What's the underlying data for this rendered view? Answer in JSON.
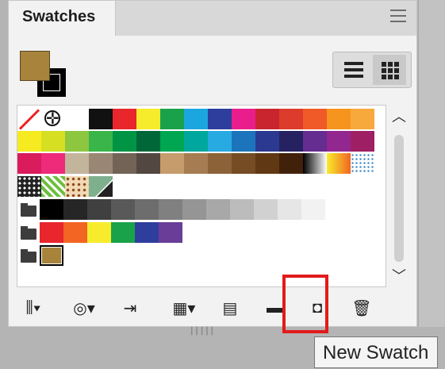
{
  "panel": {
    "tab_title": "Swatches",
    "menu_icon": "hamburger-menu-icon"
  },
  "view_toggle": {
    "list_icon": "list-view-icon",
    "grid_icon": "grid-view-icon",
    "active": "grid"
  },
  "fill_color": "#a7833c",
  "stroke_color": "#000000",
  "swatch_rows": [
    [
      "none",
      "registration",
      "#ffffff",
      "#111111",
      "#e8262c",
      "#f7ec2c",
      "#1aa24a",
      "#1ca6df",
      "#2e3e9c",
      "#e91e8c",
      "#c8252f",
      "#dd3b2b",
      "#f05a28",
      "#f7941d",
      "#f7a93b"
    ],
    [
      "#f6eb20",
      "#d7df23",
      "#8dc63f",
      "#39b54a",
      "#009444",
      "#006838",
      "#00a651",
      "#00a79d",
      "#27aae1",
      "#1c75bc",
      "#2b3990",
      "#262262",
      "#662d91",
      "#92278f",
      "#9e1f63"
    ],
    [
      "#da1c5c",
      "#ee2a7b",
      "#c2b59b",
      "#998675",
      "#736357",
      "#534741",
      "#c69c6d",
      "#a67c52",
      "#8c6239",
      "#754c24",
      "#603813",
      "#42210b",
      "gradient-bw",
      "gradient-orange",
      "pattern-dots"
    ],
    [
      "pattern-dots-2",
      "pattern-leaves",
      "pattern-floral",
      "pattern-stripes"
    ],
    [
      "folder",
      "#000000",
      "#262626",
      "#404040",
      "#595959",
      "#6d6d6d",
      "#808080",
      "#959595",
      "#a8a8a8",
      "#bcbcbc",
      "#d1d1d1",
      "#e6e6e6",
      "#f2f2f2"
    ],
    [
      "folder",
      "#e8262c",
      "#f26522",
      "#f7ec2c",
      "#1aa24a",
      "#2e3e9c",
      "#6a3d98"
    ],
    [
      "folder",
      "selected:#a7833c"
    ]
  ],
  "toolbar": [
    {
      "name": "swatch-libraries-menu-button",
      "icon": "libraries-icon",
      "glyph": "⫼▾"
    },
    {
      "name": "show-kinds-button",
      "icon": "show-kinds-icon",
      "glyph": "◎▾"
    },
    {
      "name": "place-swatches-button",
      "icon": "place-swatches-icon",
      "glyph": "⇥"
    },
    {
      "name": "color-group-button",
      "icon": "color-group-icon",
      "glyph": "▦▾"
    },
    {
      "name": "swatch-options-button",
      "icon": "swatch-options-icon",
      "glyph": "▤"
    },
    {
      "name": "new-color-group-button",
      "icon": "folder-icon",
      "glyph": "▬"
    },
    {
      "name": "new-swatch-button",
      "icon": "new-swatch-icon",
      "glyph": "◘"
    },
    {
      "name": "delete-swatch-button",
      "icon": "trash-icon",
      "glyph": "🗑"
    }
  ],
  "tooltip": "New Swatch",
  "colors": {
    "highlight": "#e21b1b",
    "panel_bg": "#f2f2f2"
  }
}
